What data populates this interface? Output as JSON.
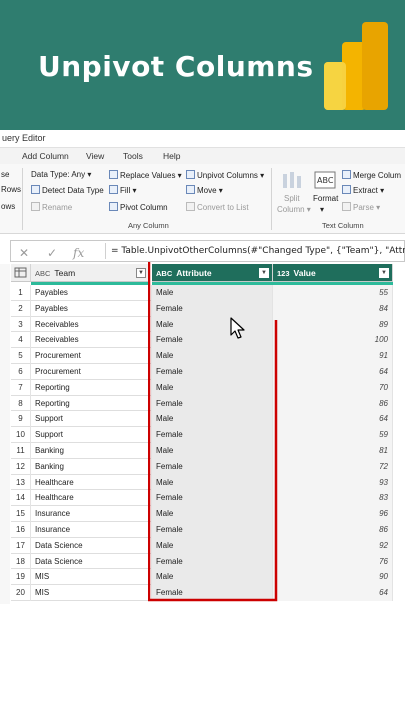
{
  "banner": {
    "title": "Unpivot Columns"
  },
  "window": {
    "title": "uery Editor"
  },
  "tabs": [
    "Add Column",
    "View",
    "Tools",
    "Help"
  ],
  "ribbon": {
    "left_fragments": [
      "se",
      "Rows",
      "ows"
    ],
    "data_type": "Data Type: Any",
    "detect_type": "Detect Data Type",
    "rename": "Rename",
    "replace_values": "Replace Values",
    "fill": "Fill",
    "pivot_column": "Pivot Column",
    "unpivot_columns": "Unpivot Columns",
    "move": "Move",
    "convert_to_list": "Convert to List",
    "any_column_group": "Any Column",
    "split_column": "Split",
    "split_column2": "Column",
    "format": "Format",
    "merge_columns": "Merge Colum",
    "extract": "Extract",
    "parse": "Parse",
    "text_column_group": "Text Column"
  },
  "formula_bar": {
    "formula": "= Table.UnpivotOtherColumns(#\"Changed Type\", {\"Team\"}, \"Attri"
  },
  "columns": [
    {
      "type": "ABC",
      "name": "Team"
    },
    {
      "type": "ABC",
      "name": "Attribute"
    },
    {
      "type": "123",
      "name": "Value"
    }
  ],
  "rows": [
    {
      "n": "1",
      "team": "Payables",
      "attr": "Male",
      "val": "55"
    },
    {
      "n": "2",
      "team": "Payables",
      "attr": "Female",
      "val": "84"
    },
    {
      "n": "3",
      "team": "Receivables",
      "attr": "Male",
      "val": "89"
    },
    {
      "n": "4",
      "team": "Receivables",
      "attr": "Female",
      "val": "100"
    },
    {
      "n": "5",
      "team": "Procurement",
      "attr": "Male",
      "val": "91"
    },
    {
      "n": "6",
      "team": "Procurement",
      "attr": "Female",
      "val": "64"
    },
    {
      "n": "7",
      "team": "Reporting",
      "attr": "Male",
      "val": "70"
    },
    {
      "n": "8",
      "team": "Reporting",
      "attr": "Female",
      "val": "86"
    },
    {
      "n": "9",
      "team": "Support",
      "attr": "Male",
      "val": "64"
    },
    {
      "n": "10",
      "team": "Support",
      "attr": "Female",
      "val": "59"
    },
    {
      "n": "11",
      "team": "Banking",
      "attr": "Male",
      "val": "81"
    },
    {
      "n": "12",
      "team": "Banking",
      "attr": "Female",
      "val": "72"
    },
    {
      "n": "13",
      "team": "Healthcare",
      "attr": "Male",
      "val": "93"
    },
    {
      "n": "14",
      "team": "Healthcare",
      "attr": "Female",
      "val": "83"
    },
    {
      "n": "15",
      "team": "Insurance",
      "attr": "Male",
      "val": "96"
    },
    {
      "n": "16",
      "team": "Insurance",
      "attr": "Female",
      "val": "86"
    },
    {
      "n": "17",
      "team": "Data Science",
      "attr": "Male",
      "val": "92"
    },
    {
      "n": "18",
      "team": "Data Science",
      "attr": "Female",
      "val": "76"
    },
    {
      "n": "19",
      "team": "MIS",
      "attr": "Male",
      "val": "90"
    },
    {
      "n": "20",
      "team": "MIS",
      "attr": "Female",
      "val": "64"
    }
  ],
  "colors": {
    "banner_bg": "#2f7d6f",
    "selected_header": "#1f6e5c",
    "highlight_box": "#cc0000",
    "quality_bar": "#2dba9a"
  }
}
